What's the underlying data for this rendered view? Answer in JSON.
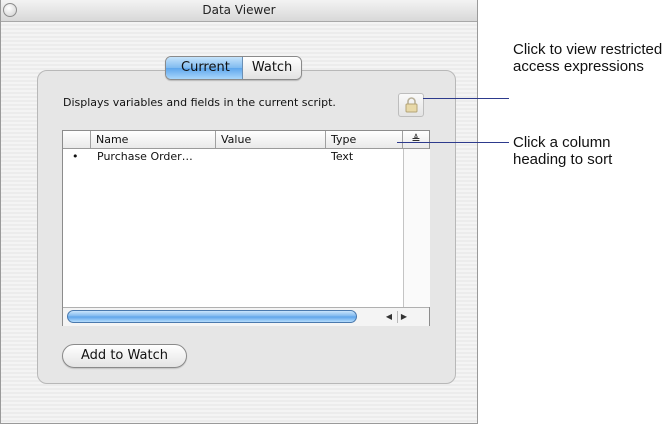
{
  "window": {
    "title": "Data Viewer"
  },
  "tabs": [
    {
      "label": "Current",
      "selected": true
    },
    {
      "label": "Watch",
      "selected": false
    }
  ],
  "description": "Displays variables and fields in the current script.",
  "lock_button": {
    "icon": "lock-icon"
  },
  "table": {
    "columns": [
      "Name",
      "Value",
      "Type"
    ],
    "sort_indicator": "≜",
    "rows": [
      {
        "bullet": "•",
        "name": "Purchase Order…",
        "value": "",
        "type": "Text"
      }
    ]
  },
  "add_button": {
    "label": "Add to Watch"
  },
  "callouts": {
    "lock": "Click to view restricted access expressions",
    "sort": "Click a column heading to sort"
  },
  "colors": {
    "selected_tab": "#7fbaf0",
    "leader_line": "#2d3a8c"
  }
}
